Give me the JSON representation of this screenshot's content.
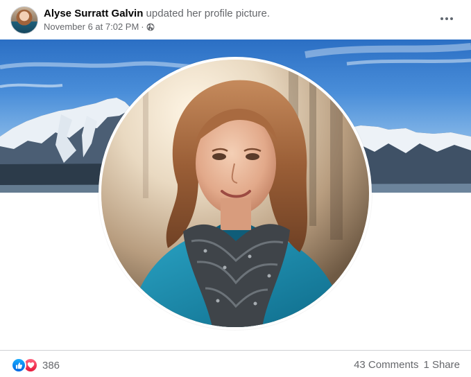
{
  "post": {
    "author": "Alyse Surratt Galvin",
    "action": " updated her profile picture.",
    "timestamp": "November 6 at 7:02 PM",
    "separator": "·",
    "audience_icon": "globe-icon",
    "more_icon": "more-options-icon"
  },
  "footer": {
    "reaction_icons": [
      "like-icon",
      "love-icon"
    ],
    "reaction_count": "386",
    "comments": "43 Comments",
    "shares": "1 Share"
  },
  "colors": {
    "like": "#1877f2",
    "love": "#f33e58",
    "secondary_text": "#65676b",
    "divider": "#ced0d4"
  }
}
